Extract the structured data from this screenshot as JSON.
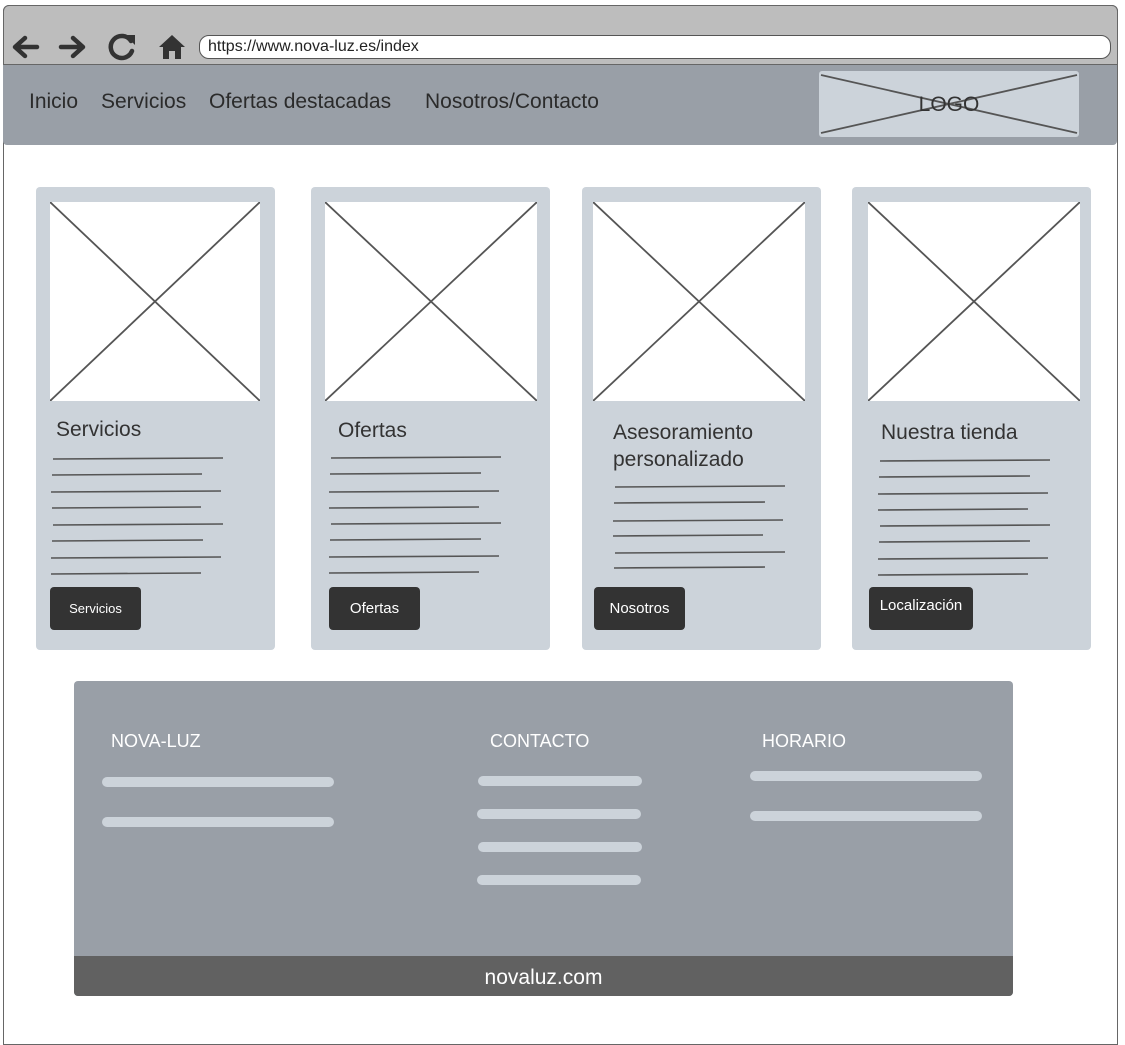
{
  "browser": {
    "url": "https://www.nova-luz.es/index",
    "icons": [
      "back-arrow-icon",
      "forward-arrow-icon",
      "reload-icon",
      "home-icon"
    ]
  },
  "nav": {
    "items": [
      "Inicio",
      "Servicios",
      "Ofertas destacadas",
      "Nosotros/Contacto"
    ],
    "logo": "LOGO"
  },
  "cards": [
    {
      "title": "Servicios",
      "button": "Servicios"
    },
    {
      "title": "Ofertas",
      "button": "Ofertas"
    },
    {
      "title_line1": "Asesoramiento",
      "title_line2": "personalizado",
      "button": "Nosotros"
    },
    {
      "title": "Nuestra tienda",
      "button": "Localización"
    }
  ],
  "footer": {
    "columns": [
      "NOVA-LUZ",
      "CONTACTO",
      "HORARIO"
    ],
    "domain": "novaluz.com"
  },
  "colors": {
    "nav_bg": "#999fa7",
    "card_bg": "#ccd3da",
    "button_bg": "#333333",
    "footer_bottom": "#616161"
  }
}
